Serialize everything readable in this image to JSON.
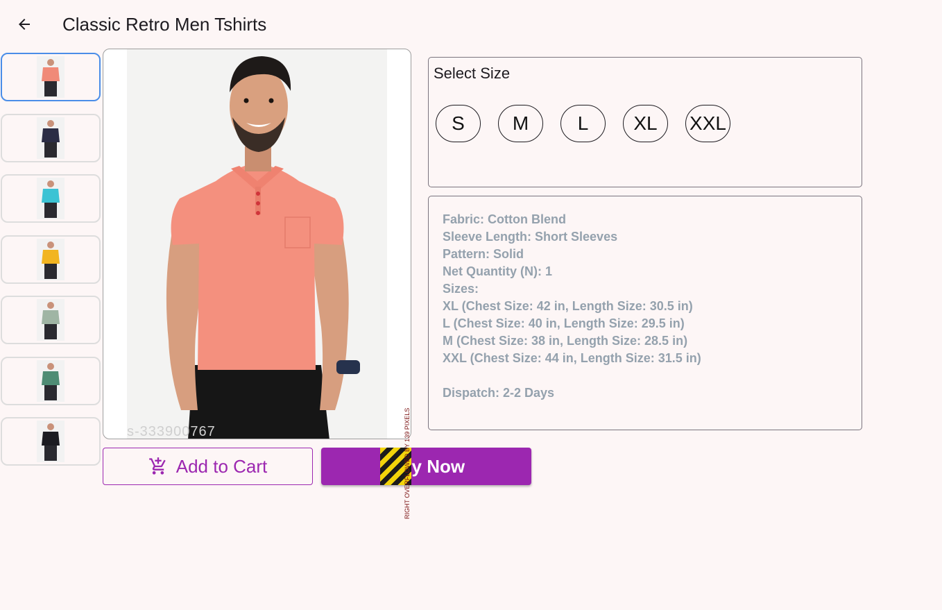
{
  "appbar": {
    "back_icon": "arrow-back-icon",
    "title": "Classic Retro Men Tshirts"
  },
  "thumbnails": [
    {
      "name": "coral-polo",
      "color": "#f08a78",
      "selected": true
    },
    {
      "name": "navy-polo",
      "color": "#2b2d45",
      "selected": false
    },
    {
      "name": "turquoise-polo",
      "color": "#3cc3d4",
      "selected": false
    },
    {
      "name": "mustard-polo",
      "color": "#f2b521",
      "selected": false
    },
    {
      "name": "sage-polo",
      "color": "#9fb5a4",
      "selected": false
    },
    {
      "name": "green-polo",
      "color": "#4e8c74",
      "selected": false
    },
    {
      "name": "black-polo",
      "color": "#1c1c22",
      "selected": false
    }
  ],
  "main_image": {
    "shirt_color": "#f4907e",
    "watermark": "s-333900767"
  },
  "size_selector": {
    "title": "Select Size",
    "sizes": [
      "S",
      "M",
      "L",
      "XL",
      "XXL"
    ]
  },
  "description": {
    "lines": [
      "Fabric: Cotton Blend",
      "Sleeve Length: Short Sleeves",
      "Pattern: Solid",
      "Net Quantity (N): 1",
      "Sizes:",
      "XL (Chest Size: 42 in, Length Size: 30.5 in)",
      "L (Chest Size: 40 in, Length Size: 29.5 in)",
      "M (Chest Size: 38 in, Length Size: 28.5 in)",
      "XXL (Chest Size: 44 in, Length Size: 31.5 in)",
      "",
      "Dispatch: 2-2 Days"
    ]
  },
  "actions": {
    "add_to_cart_label": "Add to Cart",
    "add_to_cart_icon": "add-shopping-cart-icon",
    "buy_now_label": "Buy Now"
  },
  "debug": {
    "overflow_message": "RIGHT OVERFLOWED BY 139 PIXELS"
  },
  "colors": {
    "accent": "#9c27b0",
    "selected_border": "#4a8de8",
    "background": "#fdf6f6",
    "description_text": "#94a1ad"
  }
}
